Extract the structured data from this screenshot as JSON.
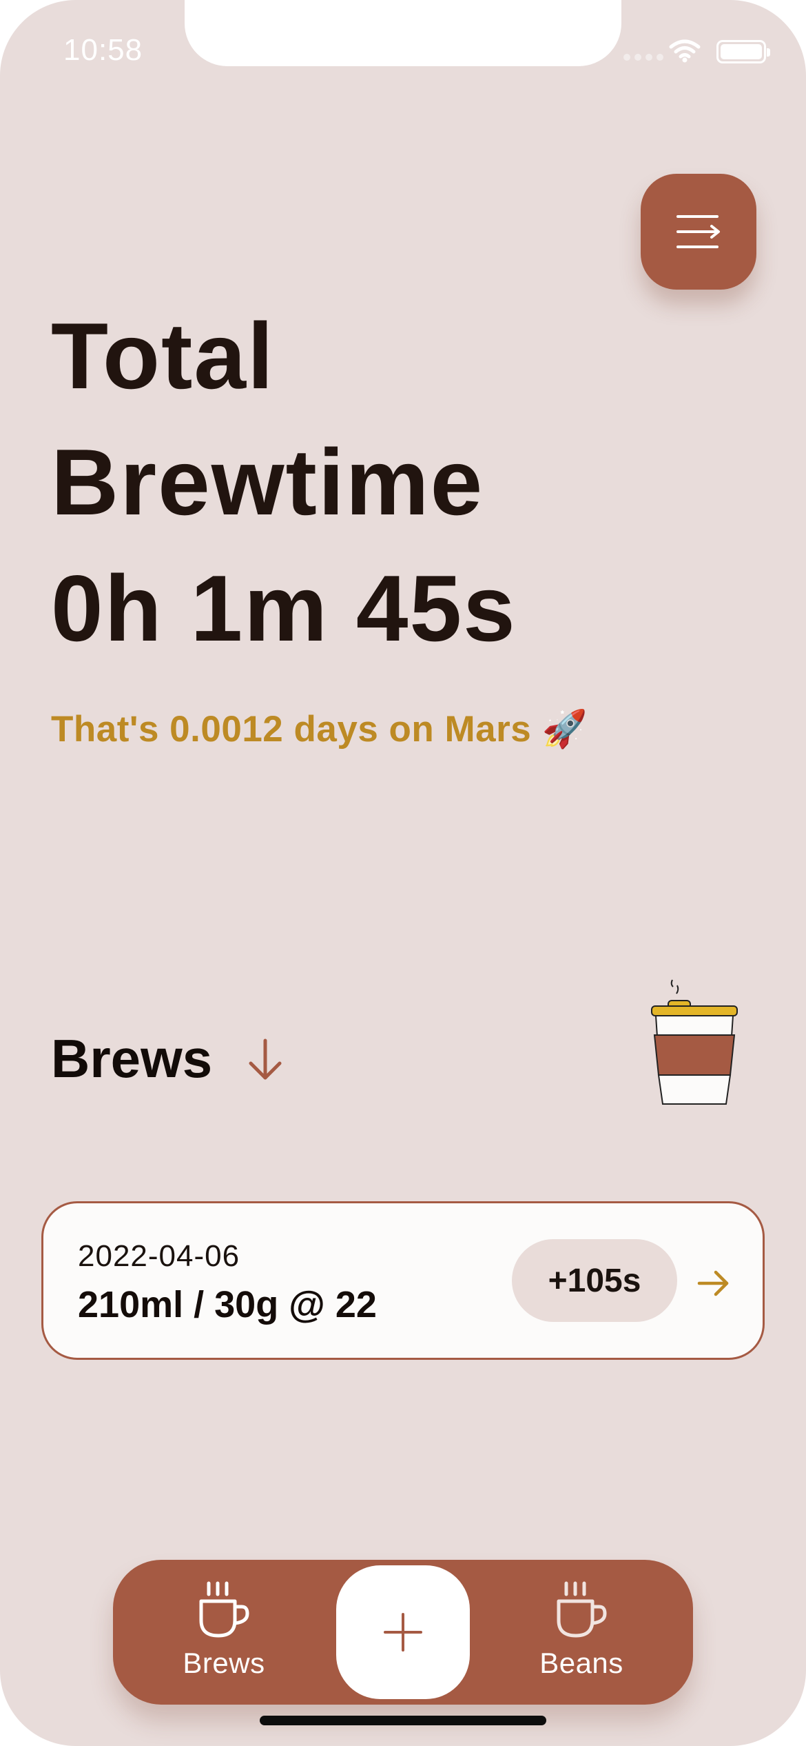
{
  "status_bar": {
    "time": "10:58"
  },
  "header": {
    "menu_icon": "menu-arrow-icon"
  },
  "stats": {
    "title_line1": "Total",
    "title_line2": "Brewtime",
    "total_time": "0h 1m 45s",
    "mars_text": "That's 0.0012 days on Mars 🚀"
  },
  "brews": {
    "heading": "Brews",
    "items": [
      {
        "date": "2022-04-06",
        "details": "210ml / 30g @ 22",
        "time_badge": "+105s"
      }
    ]
  },
  "tabbar": {
    "brews_label": "Brews",
    "beans_label": "Beans"
  },
  "colors": {
    "background": "#e8dcda",
    "accent": "#a55a43",
    "highlight": "#bd8a24",
    "text": "#21140f"
  }
}
